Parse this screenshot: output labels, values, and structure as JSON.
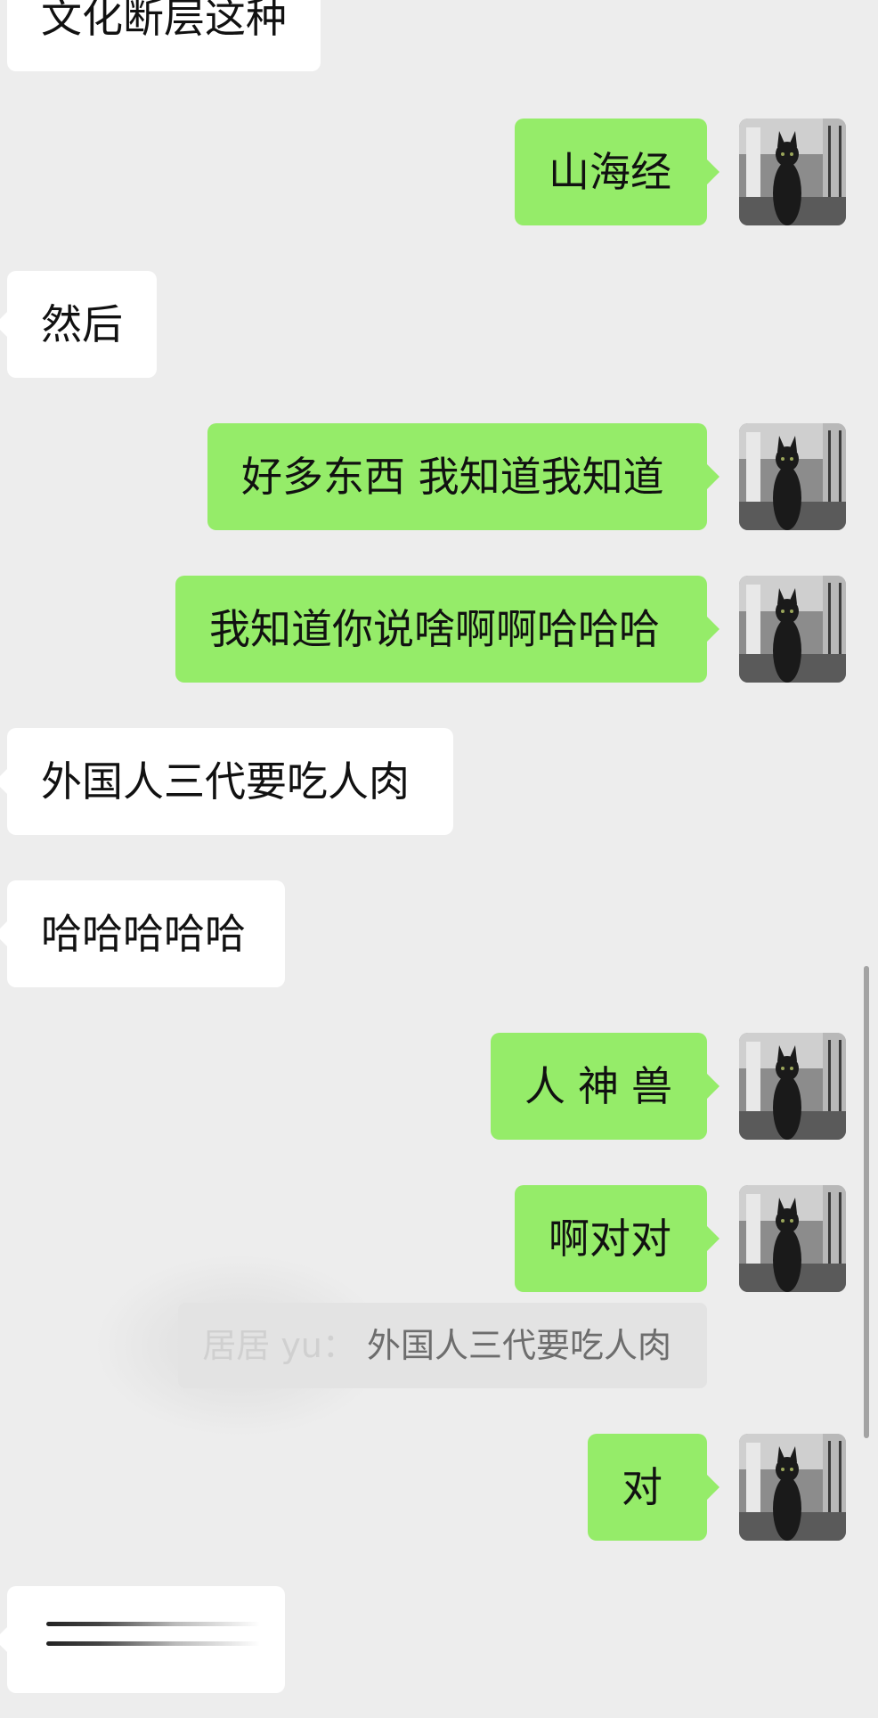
{
  "colors": {
    "background": "#ededed",
    "outgoing_bubble": "#95ec69",
    "incoming_bubble": "#ffffff",
    "quote_bg": "#e3e3e3"
  },
  "avatar_icon": "black-cat-photo-icon",
  "messages": [
    {
      "direction": "incoming",
      "text": "文化断层这种"
    },
    {
      "direction": "outgoing",
      "text": "山海经"
    },
    {
      "direction": "incoming",
      "text": "然后"
    },
    {
      "direction": "outgoing",
      "text": "好多东西 我知道我知道"
    },
    {
      "direction": "outgoing",
      "text": "我知道你说啥啊啊哈哈哈"
    },
    {
      "direction": "incoming",
      "text": "外国人三代要吃人肉"
    },
    {
      "direction": "incoming",
      "text": "哈哈哈哈哈"
    },
    {
      "direction": "outgoing",
      "text": "人神兽"
    },
    {
      "direction": "outgoing",
      "text": "啊对对"
    },
    {
      "direction": "outgoing",
      "text": "对"
    },
    {
      "direction": "incoming",
      "text": ""
    }
  ],
  "quote": {
    "sender": "居居 yu：",
    "text": "外国人三代要吃人肉"
  }
}
